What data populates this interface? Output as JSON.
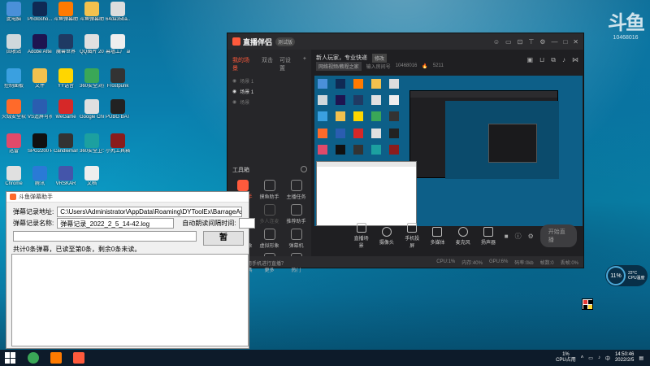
{
  "desktop": {
    "icons": [
      {
        "label": "此电脑",
        "color": "#4a90d9"
      },
      {
        "label": "Photosho...",
        "color": "#0f2a54"
      },
      {
        "label": "斗鱼弹幕助手",
        "color": "#ff7a00"
      },
      {
        "label": "斗鱼弹幕助手",
        "color": "#f2c14e"
      },
      {
        "label": "64da35ba...",
        "color": "#dddddd"
      },
      {
        "label": "回收站",
        "color": "#cfd8dc"
      },
      {
        "label": "Adobe After Effects 2020",
        "color": "#1e1450"
      },
      {
        "label": "魔兽世界",
        "color": "#1f3a63"
      },
      {
        "label": "QQ图片 20220121...",
        "color": "#e0e0e0"
      },
      {
        "label": "幕墙工厂 autosave_...",
        "color": "#eeeeee"
      },
      {
        "label": "控制面板",
        "color": "#3aa0e0"
      },
      {
        "label": "文件",
        "color": "#f2c14e"
      },
      {
        "label": "YY语音",
        "color": "#ffd600"
      },
      {
        "label": "360安全浏览器",
        "color": "#3aa757"
      },
      {
        "label": "Frostpunk",
        "color": "#333333"
      },
      {
        "label": "火绒安全软件",
        "color": "#ff6a2a"
      },
      {
        "label": "VS造屏可视通信",
        "color": "#2a5db0"
      },
      {
        "label": "WeGame",
        "color": "#d62828"
      },
      {
        "label": "Google Chrome",
        "color": "#e0e0e0"
      },
      {
        "label": "PUBG BATTLEGR...",
        "color": "#222222"
      },
      {
        "label": "迅雷",
        "color": "#e04a6a"
      },
      {
        "label": "SPG2200 Pro Gami...",
        "color": "#111111"
      },
      {
        "label": "Candleman 烛光历险...",
        "color": "#333333"
      },
      {
        "label": "360安全卫士",
        "color": "#1ca0a0"
      },
      {
        "label": "小丸工具箱",
        "color": "#8a1c1c"
      },
      {
        "label": "Chrome",
        "color": "#e0e0e0"
      },
      {
        "label": "腾讯",
        "color": "#2a7ad6"
      },
      {
        "label": "VRSKAR",
        "color": "#4455aa"
      },
      {
        "label": "文档",
        "color": "#eeeeee"
      }
    ]
  },
  "watermark": {
    "text": "斗鱼",
    "sub": "10468016"
  },
  "app": {
    "title": "直播伴侣",
    "version": "测试版",
    "title_icons": [
      "smile-icon",
      "chat-icon",
      "gift-icon",
      "shirt-icon",
      "gear-icon",
      "minimize-icon",
      "maximize-icon",
      "close-icon"
    ],
    "tabs": [
      "我的场景",
      "双击",
      "可设置"
    ],
    "scenes": [
      {
        "label": "场景 1",
        "active": false
      },
      {
        "label": "场景 1",
        "active": true
      },
      {
        "label": "场景",
        "active": false
      }
    ],
    "tools_label": "工具箱",
    "tools": [
      {
        "label": "弹幕助手",
        "state": "hl"
      },
      {
        "label": "摸鱼助手",
        "state": ""
      },
      {
        "label": "主播任务",
        "state": ""
      },
      {
        "label": "视频连麦",
        "state": ""
      },
      {
        "label": "多人连麦",
        "state": "dim"
      },
      {
        "label": "推荐助手",
        "state": ""
      },
      {
        "label": "虚拟形象",
        "state": ""
      },
      {
        "label": "虚拟形象",
        "state": ""
      },
      {
        "label": "弹幕机",
        "state": ""
      },
      {
        "label": "直播工具",
        "state": ""
      },
      {
        "label": "更多",
        "state": ""
      },
      {
        "label": "热门",
        "state": ""
      }
    ],
    "footer_hint": "如何使用手机进行直播？",
    "stream": {
      "title": "新人玩家，专业快递",
      "edit_tag": "修改",
      "category": "网络视频/教程之家",
      "room_prefix": "输入房间号",
      "room": "10468016",
      "hot": "5211"
    },
    "controls": [
      {
        "label": "直播场景"
      },
      {
        "label": "摄像头"
      },
      {
        "label": "手机投屏"
      },
      {
        "label": "多媒体"
      },
      {
        "label": "麦克风"
      },
      {
        "label": "扬声器"
      }
    ],
    "live_button": "开始直播",
    "status": [
      "CPU:1%",
      "内存:40%",
      "GPU:6%",
      "码率:0kb",
      "帧数:0",
      "丢帧:0%"
    ]
  },
  "barrage": {
    "title": "斗鱼弹幕助手",
    "path_label": "弹幕记录地址:",
    "path_value": "C:\\Users\\Administrator\\AppData\\Roaming\\DYToolEx\\BarrageAssistant",
    "name_label": "弹幕记录名称:",
    "name_value": "弹幕记录_2022_2_5_14-42.log",
    "auto_label": "自动朗读间隔时间:",
    "button": "暂",
    "info": "共计0条弹幕，已读至第0条，剩余0条未读。"
  },
  "cpu_widget": {
    "percent": "11%",
    "temp": "22°C",
    "label": "CPU温度"
  },
  "taskbar": {
    "cpu_percent": "1%",
    "cpu_label": "CPU占用",
    "time": "14:50:46",
    "date": "2022/2/5"
  }
}
